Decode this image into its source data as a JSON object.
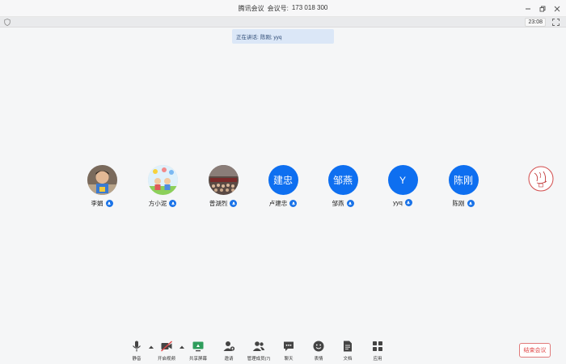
{
  "window": {
    "app_title": "腾讯会议",
    "meeting_label": "会议号:",
    "meeting_id": "173 018 300"
  },
  "infobar": {
    "clock": "23:08"
  },
  "speaking": {
    "label": "正在讲话:",
    "names": "陈刚; yyq"
  },
  "participants": [
    {
      "name": "李娟",
      "avatar_type": "photo",
      "avatar_text": ""
    },
    {
      "name": "方小泥",
      "avatar_type": "photo",
      "avatar_text": ""
    },
    {
      "name": "曾湖烈",
      "avatar_type": "photo",
      "avatar_text": ""
    },
    {
      "name": "卢建忠",
      "avatar_type": "initials",
      "avatar_text": "建忠"
    },
    {
      "name": "邹燕",
      "avatar_type": "initials",
      "avatar_text": "邹燕"
    },
    {
      "name": "yyq",
      "avatar_type": "initials",
      "avatar_text": "Y"
    },
    {
      "name": "陈刚",
      "avatar_type": "initials",
      "avatar_text": "陈刚"
    }
  ],
  "toolbar": {
    "mute": "静音",
    "video": "开启视频",
    "share": "共享屏幕",
    "invite": "邀请",
    "manage": "管理成员(7)",
    "chat": "聊天",
    "reactions": "表情",
    "docs": "文档",
    "apps": "应用",
    "end_meeting": "结束会议"
  },
  "colors": {
    "accent": "#0e6ff0",
    "end_red": "#e04848",
    "speaking_bg": "#dbe7f7"
  }
}
